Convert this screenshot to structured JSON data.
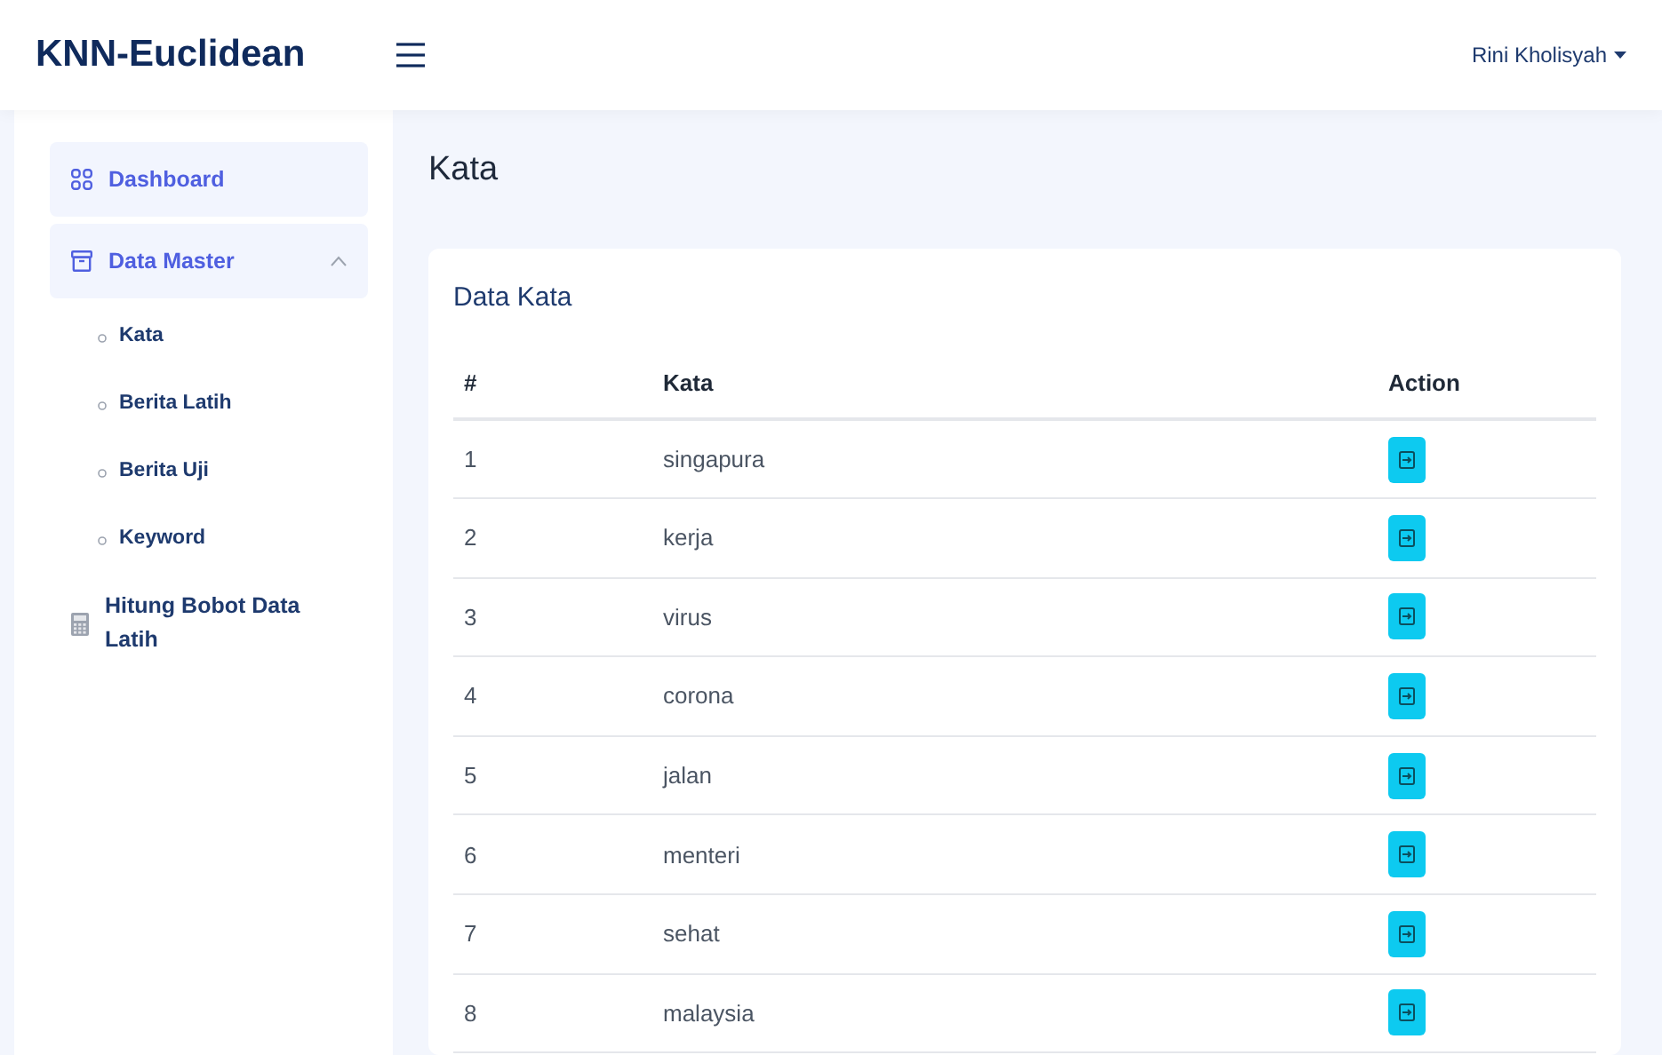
{
  "brand": "KNN-Euclidean",
  "user": {
    "name": "Rini Kholisyah"
  },
  "sidebar": {
    "items": [
      {
        "label": "Dashboard",
        "kind": "grid",
        "active": true
      },
      {
        "label": "Data Master",
        "kind": "archive",
        "active": true,
        "expanded": true,
        "children": [
          {
            "label": "Kata"
          },
          {
            "label": "Berita Latih"
          },
          {
            "label": "Berita Uji"
          },
          {
            "label": "Keyword"
          }
        ]
      },
      {
        "label": "Hitung Bobot Data Latih",
        "kind": "calculator",
        "active": false
      }
    ]
  },
  "page_title": "Kata",
  "card": {
    "title": "Data Kata",
    "table": {
      "columns": [
        "#",
        "Kata",
        "Action"
      ],
      "rows": [
        {
          "number": "1",
          "kata": "singapura"
        },
        {
          "number": "2",
          "kata": "kerja"
        },
        {
          "number": "3",
          "kata": "virus"
        },
        {
          "number": "4",
          "kata": "corona"
        },
        {
          "number": "5",
          "kata": "jalan"
        },
        {
          "number": "6",
          "kata": "menteri"
        },
        {
          "number": "7",
          "kata": "sehat"
        },
        {
          "number": "8",
          "kata": "malaysia"
        }
      ]
    }
  }
}
